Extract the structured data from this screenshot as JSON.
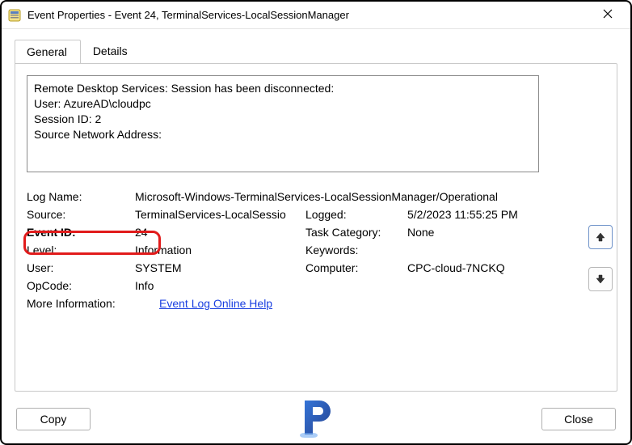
{
  "window": {
    "title": "Event Properties - Event 24, TerminalServices-LocalSessionManager"
  },
  "tabs": {
    "general": "General",
    "details": "Details"
  },
  "description": {
    "line1": "Remote Desktop Services: Session has been disconnected:",
    "blank": "",
    "user": "User: AzureAD\\cloudpc",
    "sessionId": "Session ID: 2",
    "sourceNet": "Source Network Address:"
  },
  "fields": {
    "logName": {
      "label": "Log Name:",
      "value": "Microsoft-Windows-TerminalServices-LocalSessionManager/Operational"
    },
    "source": {
      "label": "Source:",
      "value": "TerminalServices-LocalSessio"
    },
    "logged": {
      "label": "Logged:",
      "value": "5/2/2023 11:55:25 PM"
    },
    "eventId": {
      "label": "Event ID:",
      "value": "24"
    },
    "taskCategory": {
      "label": "Task Category:",
      "value": "None"
    },
    "level": {
      "label": "Level:",
      "value": "Information"
    },
    "keywords": {
      "label": "Keywords:",
      "value": ""
    },
    "user": {
      "label": "User:",
      "value": "SYSTEM"
    },
    "computer": {
      "label": "Computer:",
      "value": "CPC-cloud-7NCKQ"
    },
    "opcode": {
      "label": "OpCode:",
      "value": "Info"
    },
    "moreInfo": {
      "label": "More Information:",
      "link": "Event Log Online Help"
    }
  },
  "buttons": {
    "copy": "Copy",
    "close": "Close"
  }
}
